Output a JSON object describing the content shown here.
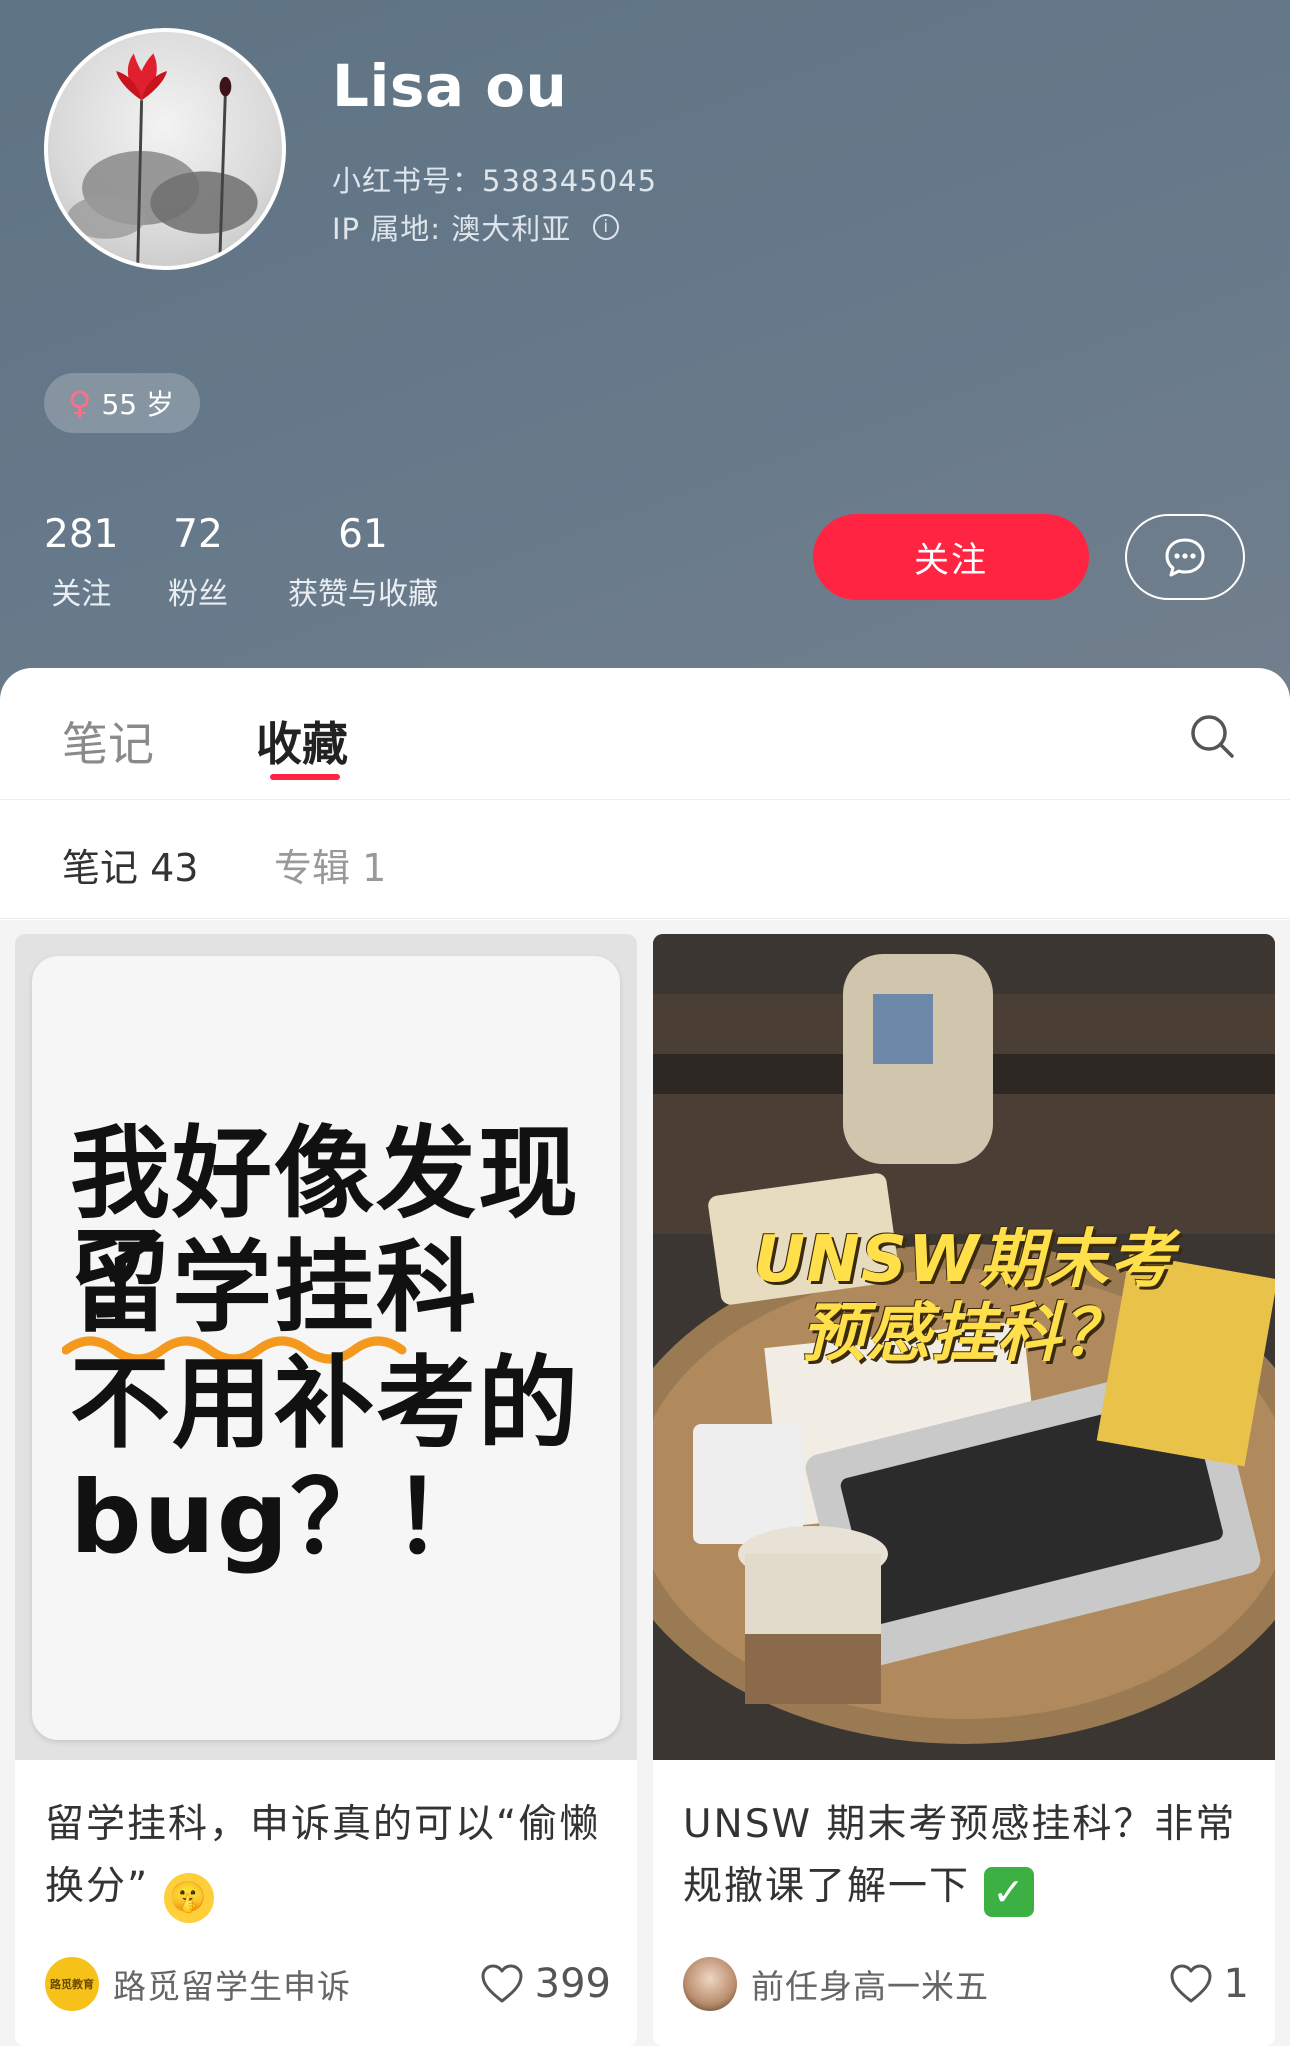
{
  "profile": {
    "name": "Lisa ou",
    "id_line": "小红书号：538345045",
    "ip_line": "IP 属地: 澳大利亚",
    "age": "55 岁",
    "gender_icon": "female-icon"
  },
  "stats": [
    {
      "value": "281",
      "label": "关注"
    },
    {
      "value": "72",
      "label": "粉丝"
    },
    {
      "value": "61",
      "label": "获赞与收藏"
    }
  ],
  "actions": {
    "follow_label": "关注",
    "message_icon": "chat-bubble-icon"
  },
  "tabs": [
    {
      "label": "笔记",
      "active": false
    },
    {
      "label": "收藏",
      "active": true
    }
  ],
  "subtabs": [
    {
      "label": "笔记 43",
      "active": true
    },
    {
      "label": "专辑 1",
      "active": false
    }
  ],
  "cards": [
    {
      "cover_lines": [
        "我好像发现了",
        "留学挂科",
        "不用补考的",
        "bug？！"
      ],
      "title": "留学挂科，申诉真的可以“偷懒换分”",
      "title_emoji": "🤫",
      "author": "路觅留学生申诉",
      "author_avatar_text": "路觅教育",
      "likes": "399"
    },
    {
      "cover_lines": [
        "UNSW期末考",
        "预感挂科？"
      ],
      "title": "UNSW 期末考预感挂科？非常规撤课了解一下",
      "title_emoji": "✓",
      "author": "前任身高一米五",
      "likes": "1"
    }
  ],
  "colors": {
    "accent": "#ff2442",
    "header_bg": "#66798a",
    "overlay_text": "#ffe04a"
  }
}
